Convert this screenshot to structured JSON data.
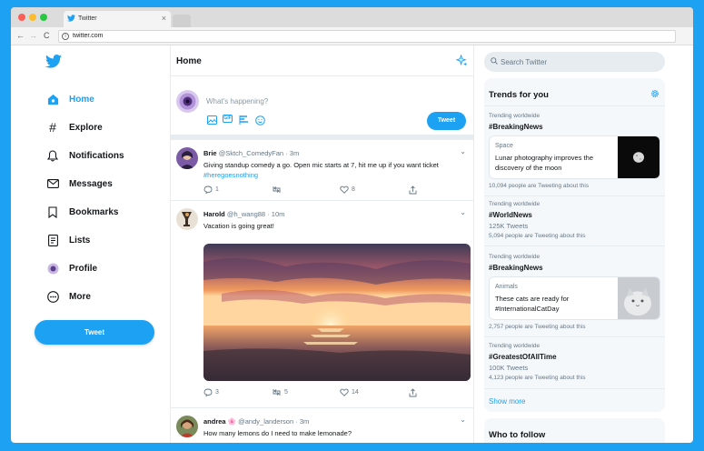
{
  "browser": {
    "tab_title": "Twitter",
    "tab_close": "×",
    "url": "twitter.com"
  },
  "sidebar": {
    "items": [
      {
        "label": "Home",
        "icon": "home-icon"
      },
      {
        "label": "Explore",
        "icon": "hash-icon"
      },
      {
        "label": "Notifications",
        "icon": "bell-icon"
      },
      {
        "label": "Messages",
        "icon": "envelope-icon"
      },
      {
        "label": "Bookmarks",
        "icon": "bookmark-icon"
      },
      {
        "label": "Lists",
        "icon": "list-icon"
      },
      {
        "label": "Profile",
        "icon": "avatar-icon"
      },
      {
        "label": "More",
        "icon": "more-icon"
      }
    ],
    "tweet_button": "Tweet"
  },
  "main": {
    "title": "Home",
    "compose_placeholder": "What's happening?",
    "compose_button": "Tweet",
    "gif_label": "GIF",
    "tweets": [
      {
        "name": "Brie",
        "handle": "@Sktch_ComedyFan",
        "time": "· 3m",
        "text": "Giving standup comedy a go. Open mic starts at 7, hit me up if you want ticket ",
        "link": "#heregoesnothing",
        "replies": "1",
        "retweets": "",
        "likes": "8"
      },
      {
        "name": "Harold",
        "handle": "@h_wang88",
        "time": "· 10m",
        "text": "Vacation is going great!",
        "replies": "3",
        "retweets": "5",
        "likes": "14"
      },
      {
        "name": "andrea",
        "emoji": "🌸",
        "handle": "@andy_landerson",
        "time": "· 3m",
        "text": "How many lemons do I need to make lemonade?"
      }
    ]
  },
  "right": {
    "search_placeholder": "Search Twitter",
    "trends_title": "Trends for you",
    "trends": [
      {
        "context": "Trending worldwide",
        "tag": "#BreakingNews",
        "card_category": "Space",
        "card_text": "Lunar photography improves the discovery of the moon",
        "meta": "10,094 people are Tweeting about this"
      },
      {
        "context": "Trending worldwide",
        "tag": "#WorldNews",
        "sub": "125K Tweets",
        "meta": "5,094 people are Tweeting about this"
      },
      {
        "context": "Trending worldwide",
        "tag": "#BreakingNews",
        "card_category": "Animals",
        "card_text": "These cats are ready for #InternationalCatDay",
        "meta": "2,757 people are Tweeting about this"
      },
      {
        "context": "Trending worldwide",
        "tag": "#GreatestOfAllTime",
        "sub": "100K Tweets",
        "meta": "4,123 people are Tweeting about this"
      }
    ],
    "show_more": "Show more",
    "who_to_follow": "Who to follow"
  },
  "colors": {
    "brand": "#1da1f2",
    "text": "#14171a",
    "muted": "#657786"
  }
}
